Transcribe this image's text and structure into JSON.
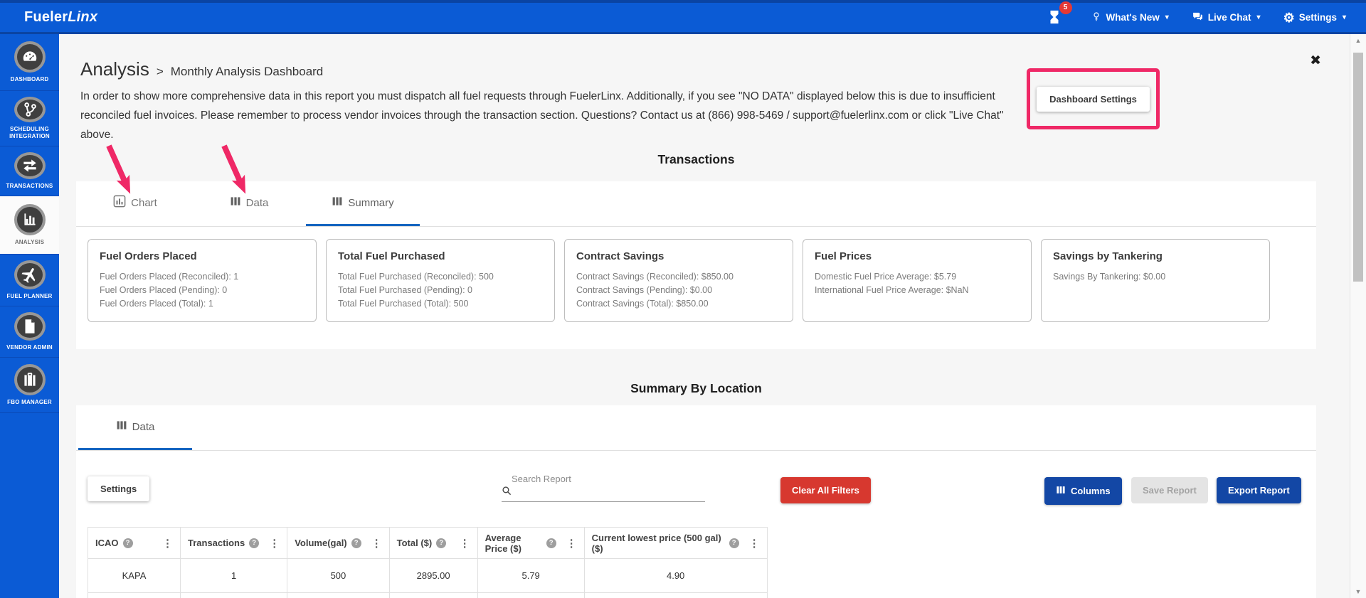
{
  "header": {
    "logo_primary": "Fueler",
    "logo_secondary": "Linx",
    "notification_count": "5",
    "whats_new_label": "What's New",
    "live_chat_label": "Live Chat",
    "settings_label": "Settings",
    "caret": "▾",
    "gear_glyph": "⚙"
  },
  "sidebar": {
    "items": [
      {
        "label": "DASHBOARD",
        "icon": "gauge-icon",
        "active": false
      },
      {
        "label": "SCHEDULING INTEGRATION",
        "icon": "git-branch-icon",
        "active": false
      },
      {
        "label": "TRANSACTIONS",
        "icon": "swap-arrows-icon",
        "active": false
      },
      {
        "label": "ANALYSIS",
        "icon": "bar-chart-icon",
        "active": true
      },
      {
        "label": "FUEL PLANNER",
        "icon": "airplane-icon",
        "active": false
      },
      {
        "label": "VENDOR ADMIN",
        "icon": "document-icon",
        "active": false
      },
      {
        "label": "FBO MANAGER",
        "icon": "briefcase-icon",
        "active": false
      }
    ]
  },
  "page": {
    "title": "Analysis",
    "separator": ">",
    "subtitle": "Monthly Analysis Dashboard",
    "intro": "In order to show more comprehensive data in this report you must dispatch all fuel requests through FuelerLinx. Additionally, if you see \"NO DATA\" displayed below this is due to insufficient reconciled fuel invoices. Please remember to process vendor invoices through the transaction section. Questions? Contact us at (866) 998-5469 / support@fuelerlinx.com or click \"Live Chat\" above.",
    "dashboard_settings_label": "Dashboard Settings",
    "close_glyph": "✖"
  },
  "transactions": {
    "heading": "Transactions",
    "tabs": {
      "chart": "Chart",
      "data": "Data",
      "summary": "Summary"
    },
    "cards": [
      {
        "title": "Fuel Orders Placed",
        "lines": [
          "Fuel Orders Placed (Reconciled): 1",
          "Fuel Orders Placed (Pending): 0",
          "Fuel Orders Placed (Total): 1"
        ]
      },
      {
        "title": "Total Fuel Purchased",
        "lines": [
          "Total Fuel Purchased (Reconciled): 500",
          "Total Fuel Purchased (Pending): 0",
          "Total Fuel Purchased (Total): 500"
        ]
      },
      {
        "title": "Contract Savings",
        "lines": [
          "Contract Savings (Reconciled): $850.00",
          "Contract Savings (Pending): $0.00",
          "Contract Savings (Total): $850.00"
        ]
      },
      {
        "title": "Fuel Prices",
        "lines": [
          "Domestic Fuel Price Average: $5.79",
          "International Fuel Price Average: $NaN"
        ]
      },
      {
        "title": "Savings by Tankering",
        "lines": [
          "Savings By Tankering: $0.00"
        ]
      }
    ]
  },
  "summary_by_location": {
    "heading": "Summary By Location",
    "tab_data": "Data",
    "toolbar": {
      "settings": "Settings",
      "search_label": "Search Report",
      "clear_filters": "Clear All Filters",
      "columns": "Columns",
      "save_report": "Save Report",
      "export_report": "Export Report"
    },
    "table": {
      "columns": [
        "ICAO",
        "Transactions",
        "Volume(gal)",
        "Total ($)",
        "Average Price ($)",
        "Current lowest price (500 gal) ($)"
      ],
      "rows": [
        [
          "KAPA",
          "1",
          "500",
          "2895.00",
          "5.79",
          "4.90"
        ]
      ],
      "help_glyph": "?",
      "menu_glyph": "⋮"
    }
  },
  "colors": {
    "header_blue": "#0b5bd5",
    "annotation_pink": "#ef2866",
    "danger_red": "#d7382f",
    "primary_blue": "#1347a5",
    "tab_active_blue": "#1565c0",
    "disabled_gray": "#e4e4e4"
  }
}
